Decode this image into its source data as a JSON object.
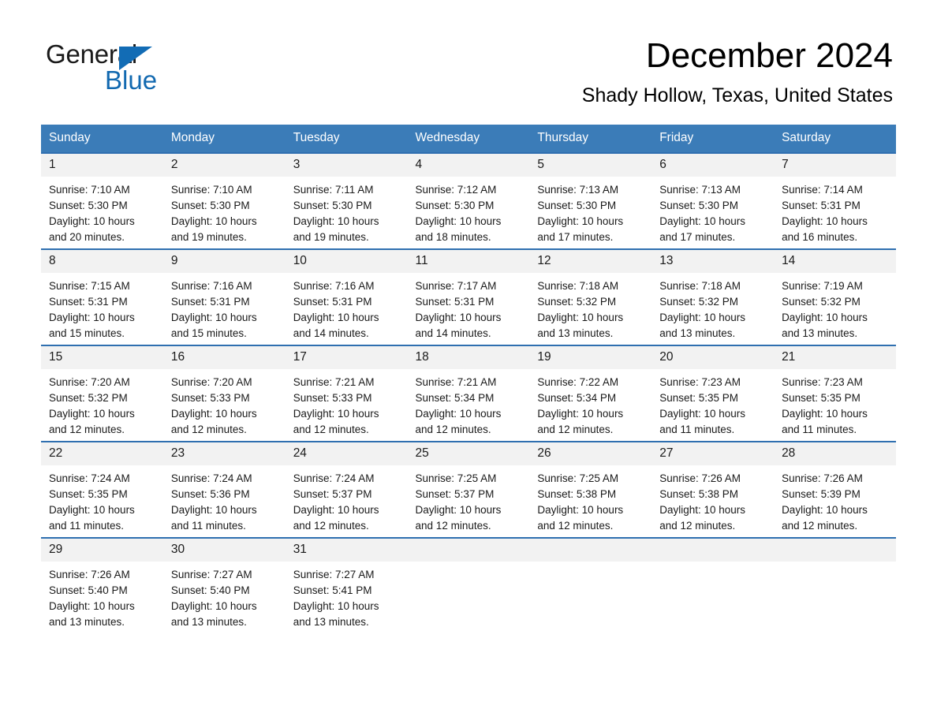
{
  "brand": {
    "name_part1": "General",
    "name_part2": "Blue"
  },
  "header": {
    "month_title": "December 2024",
    "location": "Shady Hollow, Texas, United States"
  },
  "theme": {
    "header_blue": "#3b7cb8",
    "rule_blue": "#2f6fb0",
    "daynum_bg": "#f2f2f2",
    "logo_blue": "#1269b0"
  },
  "weekdays": [
    "Sunday",
    "Monday",
    "Tuesday",
    "Wednesday",
    "Thursday",
    "Friday",
    "Saturday"
  ],
  "weeks": [
    [
      {
        "day": "1",
        "sunrise": "Sunrise: 7:10 AM",
        "sunset": "Sunset: 5:30 PM",
        "daylight_line1": "Daylight: 10 hours",
        "daylight_line2": "and 20 minutes."
      },
      {
        "day": "2",
        "sunrise": "Sunrise: 7:10 AM",
        "sunset": "Sunset: 5:30 PM",
        "daylight_line1": "Daylight: 10 hours",
        "daylight_line2": "and 19 minutes."
      },
      {
        "day": "3",
        "sunrise": "Sunrise: 7:11 AM",
        "sunset": "Sunset: 5:30 PM",
        "daylight_line1": "Daylight: 10 hours",
        "daylight_line2": "and 19 minutes."
      },
      {
        "day": "4",
        "sunrise": "Sunrise: 7:12 AM",
        "sunset": "Sunset: 5:30 PM",
        "daylight_line1": "Daylight: 10 hours",
        "daylight_line2": "and 18 minutes."
      },
      {
        "day": "5",
        "sunrise": "Sunrise: 7:13 AM",
        "sunset": "Sunset: 5:30 PM",
        "daylight_line1": "Daylight: 10 hours",
        "daylight_line2": "and 17 minutes."
      },
      {
        "day": "6",
        "sunrise": "Sunrise: 7:13 AM",
        "sunset": "Sunset: 5:30 PM",
        "daylight_line1": "Daylight: 10 hours",
        "daylight_line2": "and 17 minutes."
      },
      {
        "day": "7",
        "sunrise": "Sunrise: 7:14 AM",
        "sunset": "Sunset: 5:31 PM",
        "daylight_line1": "Daylight: 10 hours",
        "daylight_line2": "and 16 minutes."
      }
    ],
    [
      {
        "day": "8",
        "sunrise": "Sunrise: 7:15 AM",
        "sunset": "Sunset: 5:31 PM",
        "daylight_line1": "Daylight: 10 hours",
        "daylight_line2": "and 15 minutes."
      },
      {
        "day": "9",
        "sunrise": "Sunrise: 7:16 AM",
        "sunset": "Sunset: 5:31 PM",
        "daylight_line1": "Daylight: 10 hours",
        "daylight_line2": "and 15 minutes."
      },
      {
        "day": "10",
        "sunrise": "Sunrise: 7:16 AM",
        "sunset": "Sunset: 5:31 PM",
        "daylight_line1": "Daylight: 10 hours",
        "daylight_line2": "and 14 minutes."
      },
      {
        "day": "11",
        "sunrise": "Sunrise: 7:17 AM",
        "sunset": "Sunset: 5:31 PM",
        "daylight_line1": "Daylight: 10 hours",
        "daylight_line2": "and 14 minutes."
      },
      {
        "day": "12",
        "sunrise": "Sunrise: 7:18 AM",
        "sunset": "Sunset: 5:32 PM",
        "daylight_line1": "Daylight: 10 hours",
        "daylight_line2": "and 13 minutes."
      },
      {
        "day": "13",
        "sunrise": "Sunrise: 7:18 AM",
        "sunset": "Sunset: 5:32 PM",
        "daylight_line1": "Daylight: 10 hours",
        "daylight_line2": "and 13 minutes."
      },
      {
        "day": "14",
        "sunrise": "Sunrise: 7:19 AM",
        "sunset": "Sunset: 5:32 PM",
        "daylight_line1": "Daylight: 10 hours",
        "daylight_line2": "and 13 minutes."
      }
    ],
    [
      {
        "day": "15",
        "sunrise": "Sunrise: 7:20 AM",
        "sunset": "Sunset: 5:32 PM",
        "daylight_line1": "Daylight: 10 hours",
        "daylight_line2": "and 12 minutes."
      },
      {
        "day": "16",
        "sunrise": "Sunrise: 7:20 AM",
        "sunset": "Sunset: 5:33 PM",
        "daylight_line1": "Daylight: 10 hours",
        "daylight_line2": "and 12 minutes."
      },
      {
        "day": "17",
        "sunrise": "Sunrise: 7:21 AM",
        "sunset": "Sunset: 5:33 PM",
        "daylight_line1": "Daylight: 10 hours",
        "daylight_line2": "and 12 minutes."
      },
      {
        "day": "18",
        "sunrise": "Sunrise: 7:21 AM",
        "sunset": "Sunset: 5:34 PM",
        "daylight_line1": "Daylight: 10 hours",
        "daylight_line2": "and 12 minutes."
      },
      {
        "day": "19",
        "sunrise": "Sunrise: 7:22 AM",
        "sunset": "Sunset: 5:34 PM",
        "daylight_line1": "Daylight: 10 hours",
        "daylight_line2": "and 12 minutes."
      },
      {
        "day": "20",
        "sunrise": "Sunrise: 7:23 AM",
        "sunset": "Sunset: 5:35 PM",
        "daylight_line1": "Daylight: 10 hours",
        "daylight_line2": "and 11 minutes."
      },
      {
        "day": "21",
        "sunrise": "Sunrise: 7:23 AM",
        "sunset": "Sunset: 5:35 PM",
        "daylight_line1": "Daylight: 10 hours",
        "daylight_line2": "and 11 minutes."
      }
    ],
    [
      {
        "day": "22",
        "sunrise": "Sunrise: 7:24 AM",
        "sunset": "Sunset: 5:35 PM",
        "daylight_line1": "Daylight: 10 hours",
        "daylight_line2": "and 11 minutes."
      },
      {
        "day": "23",
        "sunrise": "Sunrise: 7:24 AM",
        "sunset": "Sunset: 5:36 PM",
        "daylight_line1": "Daylight: 10 hours",
        "daylight_line2": "and 11 minutes."
      },
      {
        "day": "24",
        "sunrise": "Sunrise: 7:24 AM",
        "sunset": "Sunset: 5:37 PM",
        "daylight_line1": "Daylight: 10 hours",
        "daylight_line2": "and 12 minutes."
      },
      {
        "day": "25",
        "sunrise": "Sunrise: 7:25 AM",
        "sunset": "Sunset: 5:37 PM",
        "daylight_line1": "Daylight: 10 hours",
        "daylight_line2": "and 12 minutes."
      },
      {
        "day": "26",
        "sunrise": "Sunrise: 7:25 AM",
        "sunset": "Sunset: 5:38 PM",
        "daylight_line1": "Daylight: 10 hours",
        "daylight_line2": "and 12 minutes."
      },
      {
        "day": "27",
        "sunrise": "Sunrise: 7:26 AM",
        "sunset": "Sunset: 5:38 PM",
        "daylight_line1": "Daylight: 10 hours",
        "daylight_line2": "and 12 minutes."
      },
      {
        "day": "28",
        "sunrise": "Sunrise: 7:26 AM",
        "sunset": "Sunset: 5:39 PM",
        "daylight_line1": "Daylight: 10 hours",
        "daylight_line2": "and 12 minutes."
      }
    ],
    [
      {
        "day": "29",
        "sunrise": "Sunrise: 7:26 AM",
        "sunset": "Sunset: 5:40 PM",
        "daylight_line1": "Daylight: 10 hours",
        "daylight_line2": "and 13 minutes."
      },
      {
        "day": "30",
        "sunrise": "Sunrise: 7:27 AM",
        "sunset": "Sunset: 5:40 PM",
        "daylight_line1": "Daylight: 10 hours",
        "daylight_line2": "and 13 minutes."
      },
      {
        "day": "31",
        "sunrise": "Sunrise: 7:27 AM",
        "sunset": "Sunset: 5:41 PM",
        "daylight_line1": "Daylight: 10 hours",
        "daylight_line2": "and 13 minutes."
      },
      {
        "day": "",
        "sunrise": "",
        "sunset": "",
        "daylight_line1": "",
        "daylight_line2": ""
      },
      {
        "day": "",
        "sunrise": "",
        "sunset": "",
        "daylight_line1": "",
        "daylight_line2": ""
      },
      {
        "day": "",
        "sunrise": "",
        "sunset": "",
        "daylight_line1": "",
        "daylight_line2": ""
      },
      {
        "day": "",
        "sunrise": "",
        "sunset": "",
        "daylight_line1": "",
        "daylight_line2": ""
      }
    ]
  ]
}
